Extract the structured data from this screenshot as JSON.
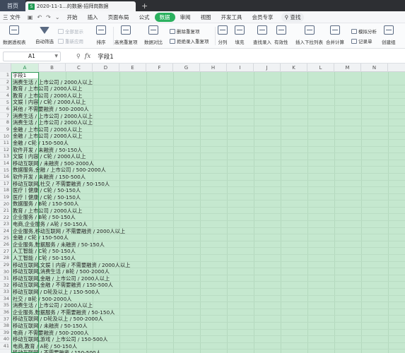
{
  "titlebar": {
    "home": "首页",
    "file_tab": "2020-11-1...的数据-招拜岗数据",
    "xls_badge": "S",
    "new_tab": "+"
  },
  "menu": {
    "file": "三 文件",
    "items": [
      "开始",
      "插入",
      "页面布局",
      "公式",
      "数据",
      "审阅",
      "视图",
      "开发工具",
      "会员专享"
    ],
    "active_index": 4,
    "search": "查找"
  },
  "ribbon": {
    "pivot": "数据透视表",
    "autofilter": "自动筛选",
    "show_all": "全部显示",
    "reapply": "重新应用",
    "sort": "排序",
    "highlight_dup": "高亮重复项",
    "data_compare": "数据对比",
    "remove_dup": "删除重复项",
    "reject_dup": "拒绝录入重复项",
    "split": "分列",
    "fill": "填充",
    "lookup": "查找录入",
    "validity": "有效性",
    "dropdown": "插入下拉列表",
    "consolidate": "合并计算",
    "record": "记录单",
    "simulate": "模拟分析",
    "group": "创建组"
  },
  "formula_bar": {
    "cell_ref": "A1",
    "fx": "fx",
    "content": "字段1"
  },
  "columns": [
    "A",
    "B",
    "C",
    "D",
    "E",
    "F",
    "G",
    "H",
    "I",
    "J",
    "K",
    "L",
    "M",
    "N"
  ],
  "row_numbers": [
    "1",
    "2",
    "3",
    "4",
    "5",
    "6",
    "7",
    "8",
    "9",
    "10",
    "11",
    "12",
    "13",
    "14",
    "15",
    "16",
    "17",
    "18",
    "19",
    "20",
    "21",
    "22",
    "23",
    "24",
    "25",
    "26",
    "27",
    "28",
    "29",
    "30",
    "31",
    "32",
    "33",
    "34",
    "35",
    "36",
    "37",
    "38",
    "39",
    "40",
    "41"
  ],
  "cells": [
    "字段1",
    "消费生活 / 上市公司 / 2000人以上",
    "教育 / 上市公司 / 2000人以上",
    "教育 / 上市公司 / 2000人以上",
    "文娱丨内容 / C轮 / 2000人以上",
    "其他 / 不需要融资 / 500-2000人",
    "消费生活 / 上市公司 / 2000人以上",
    "消费生活 / 上市公司 / 2000人以上",
    "金融 / 上市公司 / 2000人以上",
    "金融 / 上市公司 / 2000人以上",
    "金融 / C轮 / 150-500人",
    "软件开发 / 未融资 / 50-150人",
    "文娱丨内容 / C轮 / 2000人以上",
    "移动互联网 / 未融资 / 500-2000人",
    "数据服务,金融 / 上市公司 / 500-2000人",
    "软件开发 / 未融资 / 150-500人",
    "移动互联网,社交 / 不需要融资 / 50-150人",
    "医疗丨健康 / C轮 / 50-150人",
    "医疗丨健康 / C轮 / 50-150人",
    "数据服务 / B轮 / 150-500人",
    "教育 / 上市公司 / 2000人以上",
    "企业服务 / B轮 / 50-150人",
    "电商,企业服务 / A轮 / 50-150人",
    "企业服务,移动互联网 / 不需要融资 / 2000人以上",
    "金融 / C轮 / 150-500人",
    "企业服务,数据服务 / 未融资 / 50-150人",
    "人工智能 / C轮 / 50-150人",
    "人工智能 / C轮 / 50-150人",
    "移动互联网,文娱丨内容 / 不需要融资 / 2000人以上",
    "移动互联网,消费生活 / B轮 / 500-2000人",
    "移动互联网,金融 / 上市公司 / 2000人以上",
    "移动互联网,金融 / 不需要融资 / 150-500人",
    "移动互联网 / D轮及以上 / 150-500人",
    "社交 / B轮 / 500-2000人",
    "消费生活 / 上市公司 / 2000人以上",
    "企业服务,数据服务 / 不需要融资 / 50-150人",
    "移动互联网 / D轮及以上 / 500-2000人",
    "移动互联网 / 未融资 / 50-150人",
    "电商 / 不需要融资 / 500-2000人",
    "移动互联网,游戏 / 上市公司 / 150-500人",
    "电商,教育 / A轮 / 50-150人",
    "移动互联网 / 不需要融资 / 150-500人"
  ]
}
